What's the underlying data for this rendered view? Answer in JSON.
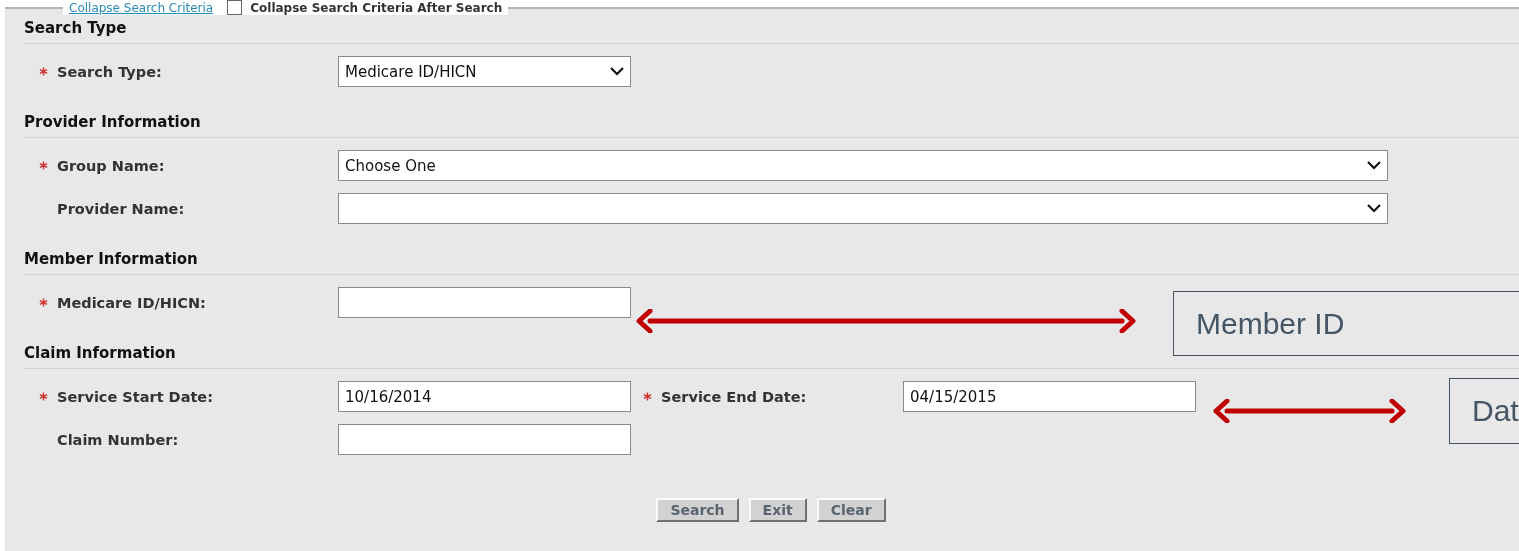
{
  "legend": {
    "link": "Collapse Search Criteria",
    "checkbox": {
      "label": "Collapse Search Criteria After Search",
      "checked": false
    }
  },
  "sections": [
    {
      "title": "Search Type",
      "rows": [
        {
          "fields": [
            {
              "label": "Search Type:",
              "required": true,
              "kind": "select",
              "value": "Medicare ID/HICN"
            }
          ]
        }
      ]
    },
    {
      "title": "Provider Information",
      "rows": [
        {
          "fields": [
            {
              "label": "Group Name:",
              "required": true,
              "kind": "wideselect",
              "value": "Choose One"
            }
          ]
        },
        {
          "fields": [
            {
              "label": "Provider Name:",
              "required": false,
              "kind": "wideselect"
            }
          ]
        }
      ]
    },
    {
      "title": "Member Information",
      "rows": [
        {
          "fields": [
            {
              "label": "Medicare ID/HICN:",
              "required": true,
              "kind": "text"
            }
          ]
        }
      ]
    },
    {
      "title": "Claim Information",
      "rows": [
        {
          "fields": [
            {
              "label": "Service Start Date:",
              "required": true,
              "kind": "text",
              "value": "10/16/2014"
            },
            {
              "label": "Service End Date:",
              "required": true,
              "kind": "text",
              "value": "04/15/2015"
            }
          ]
        },
        {
          "fields": [
            {
              "label": "Claim Number:",
              "required": false,
              "kind": "text"
            }
          ]
        }
      ]
    }
  ],
  "buttons": [
    "Search",
    "Exit",
    "Clear"
  ],
  "callouts": [
    {
      "text": "Member ID"
    },
    {
      "text": "Dat"
    }
  ]
}
